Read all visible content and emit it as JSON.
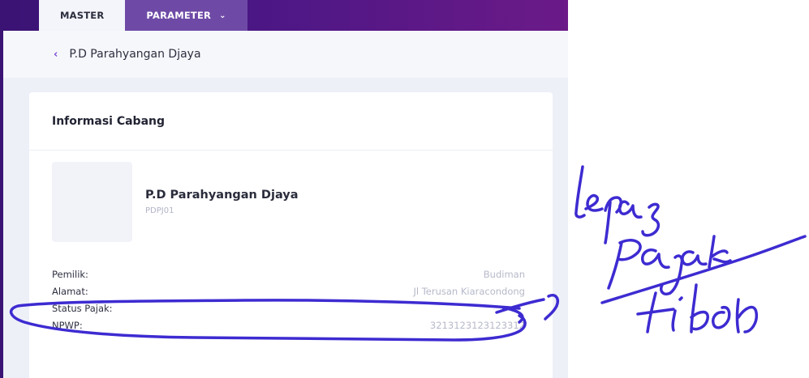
{
  "tabs": {
    "master": "MASTER",
    "parameter": "PARAMETER"
  },
  "header": {
    "title": "P.D Parahyangan Djaya"
  },
  "card": {
    "title": "Informasi Cabang",
    "branch_name": "P.D Parahyangan Djaya",
    "branch_code": "PDPJ01",
    "rows": [
      {
        "label": "Pemilik:",
        "value": "Budiman"
      },
      {
        "label": "Alamat:",
        "value": "Jl Terusan Kiaracondong"
      },
      {
        "label": "Status Pajak:",
        "value": ""
      },
      {
        "label": "NPWP:",
        "value": "3213123123123312"
      }
    ]
  },
  "icons": {
    "tab_dropdown": "chevron-down-icon",
    "back": "chevron-left-icon"
  },
  "colors": {
    "frame_purple": "#4b1785",
    "accent": "#7b4bd6",
    "ink": "#3d2bd1"
  }
}
